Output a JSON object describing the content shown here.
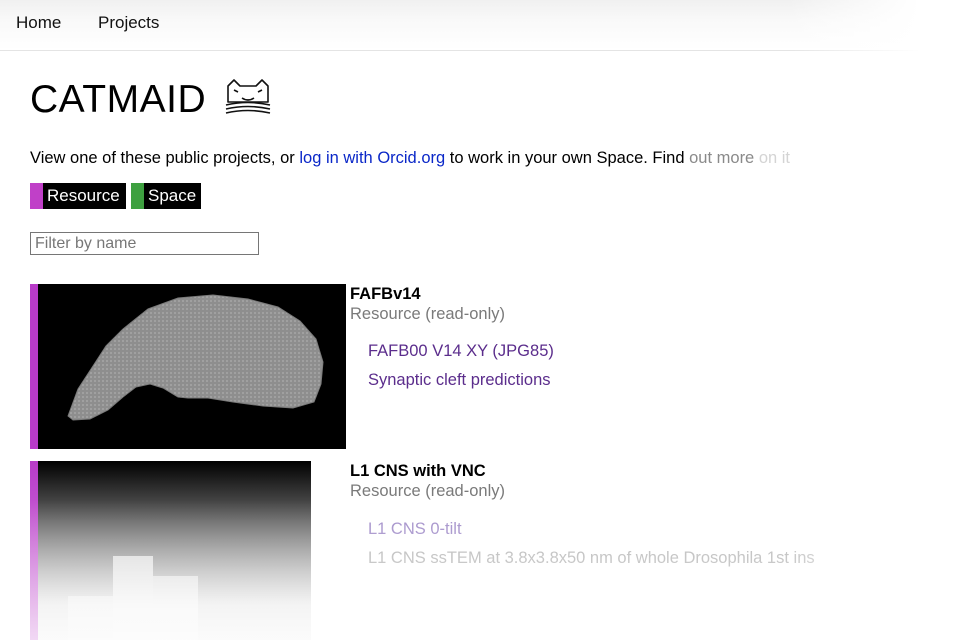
{
  "nav": {
    "home_label": "Home",
    "projects_label": "Projects"
  },
  "page": {
    "title": "CATMAID",
    "logo_icon": "cat-book-icon",
    "intro": {
      "prefix": "View one of these public projects, or ",
      "login_link": "log in with Orcid.org",
      "middle": " to work in your own Space. Find ",
      "faded_a": "out more",
      "faded_b": " on it"
    }
  },
  "legend": {
    "resource": {
      "label": "Resource",
      "color": "#c040c8"
    },
    "space": {
      "label": "Space",
      "color": "#3ea040"
    }
  },
  "filter": {
    "placeholder": "Filter by name",
    "value": ""
  },
  "projects": [
    {
      "name": "FAFBv14",
      "type": "Resource (read-only)",
      "stacks": [
        "FAFB00 V14 XY (JPG85)",
        "Synaptic cleft predictions"
      ]
    },
    {
      "name": "L1 CNS with VNC",
      "type": "Resource (read-only)",
      "stacks": [
        "L1 CNS 0-tilt",
        "L1 CNS ssTEM at 3.8x3.8x50 nm of whole Drosophila 1st ins"
      ]
    }
  ]
}
